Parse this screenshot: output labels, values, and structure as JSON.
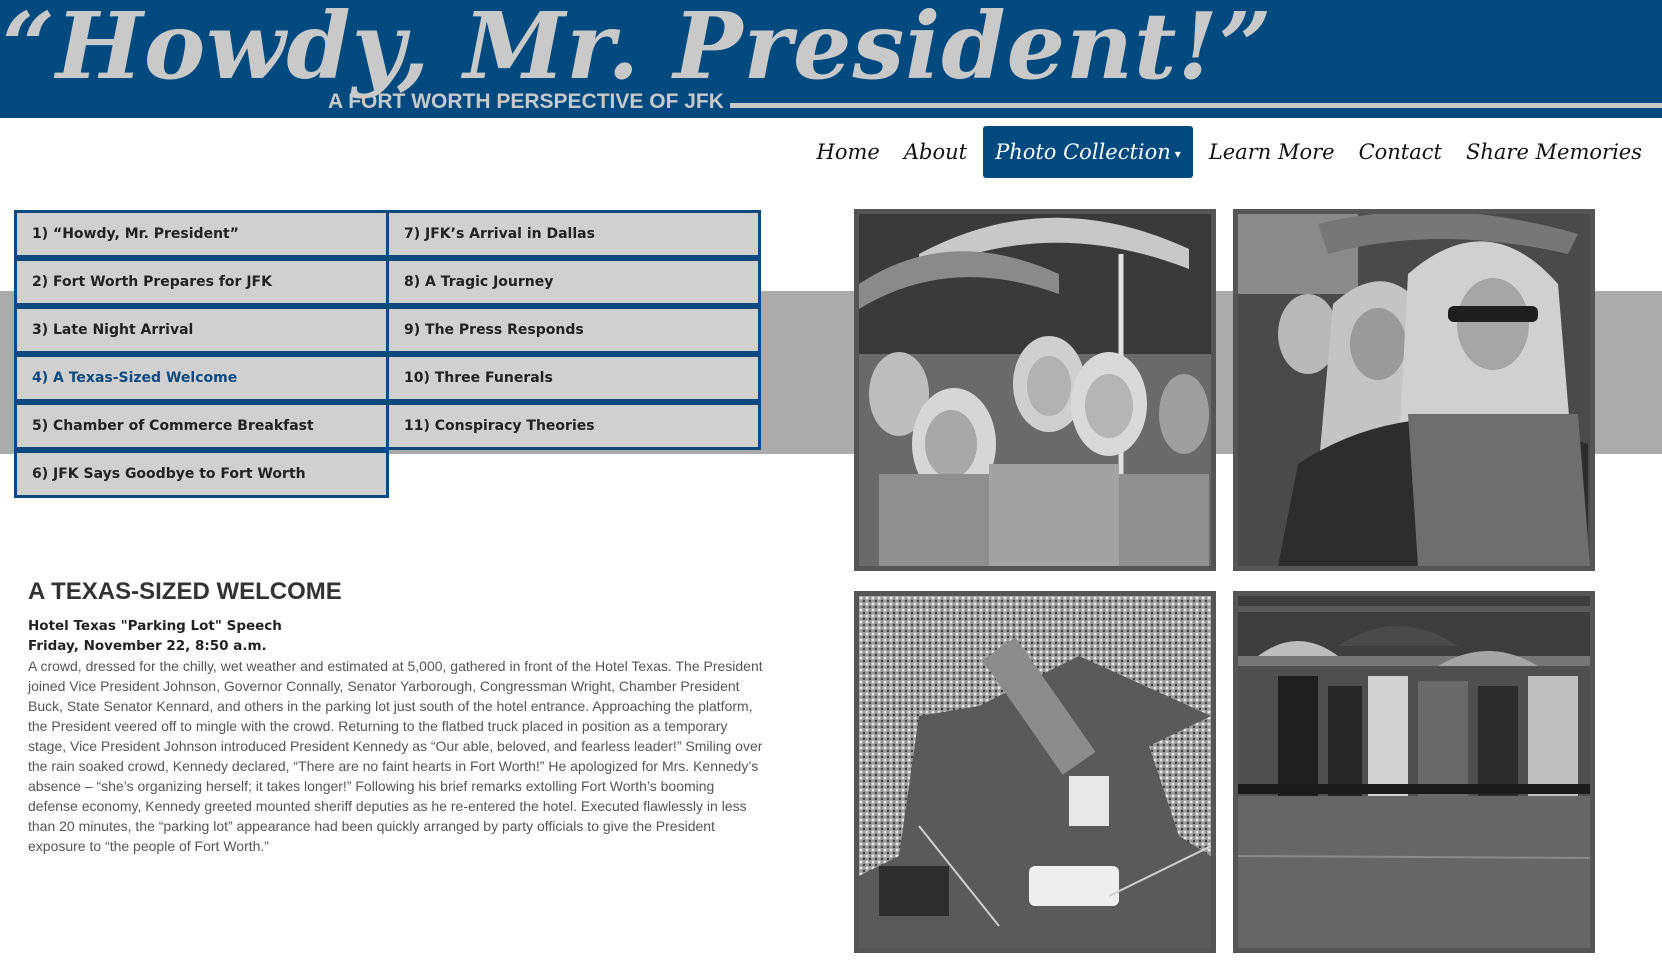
{
  "header": {
    "title": "“Howdy, Mr. President!”",
    "subtitle": "A FORT WORTH PERSPECTIVE OF JFK"
  },
  "nav": {
    "items": [
      "Home",
      "About",
      "Photo Collection",
      "Learn More",
      "Contact",
      "Share Memories"
    ],
    "active": "Photo Collection"
  },
  "chapters": [
    "1) “Howdy, Mr. President”",
    "2) Fort Worth Prepares for JFK",
    "3) Late Night Arrival",
    "4) A Texas-Sized Welcome",
    "5) Chamber of Commerce Breakfast",
    "6) JFK Says Goodbye to Fort Worth",
    "7) JFK’s Arrival in Dallas",
    "8) A Tragic Journey",
    "9) The Press Responds",
    "10) Three Funerals",
    "11) Conspiracy Theories"
  ],
  "active_chapter": "4) A Texas-Sized Welcome",
  "article": {
    "heading": "A TEXAS-SIZED WELCOME",
    "subheading": "Hotel Texas \"Parking Lot\" Speech",
    "date": "Friday, November 22, 8:50 a.m.",
    "body": "A crowd, dressed for the chilly, wet weather and estimated at 5,000, gathered in front of the Hotel Texas. The President joined Vice President Johnson, Governor Connally, Senator Yarborough, Congressman Wright, Chamber President Buck, State Senator Kennard, and others in the parking lot just south of the hotel entrance. Approaching the platform, the President veered off to mingle with the crowd. Returning to the flatbed truck placed in position as a temporary stage, Vice President Johnson introduced President Kennedy as “Our able, beloved, and fearless leader!” Smiling over the rain soaked crowd, Kennedy declared, “There are no faint hearts in Fort Worth!” He apologized for Mrs. Kennedy’s absence – “she’s organizing herself; it takes longer!” Following his brief remarks extolling Fort Worth’s booming defense economy, Kennedy greeted mounted sheriff deputies as he re-entered the hotel. Executed flawlessly in less than 20 minutes, the “parking lot” appearance had been quickly arranged by party officials to give the President exposure to “the people of Fort Worth.”"
  },
  "colors": {
    "brand_blue": "#004a80",
    "banner_text": "#c9c9c9",
    "band_gray": "#ababab",
    "tile_gray": "#d0d0d0"
  }
}
